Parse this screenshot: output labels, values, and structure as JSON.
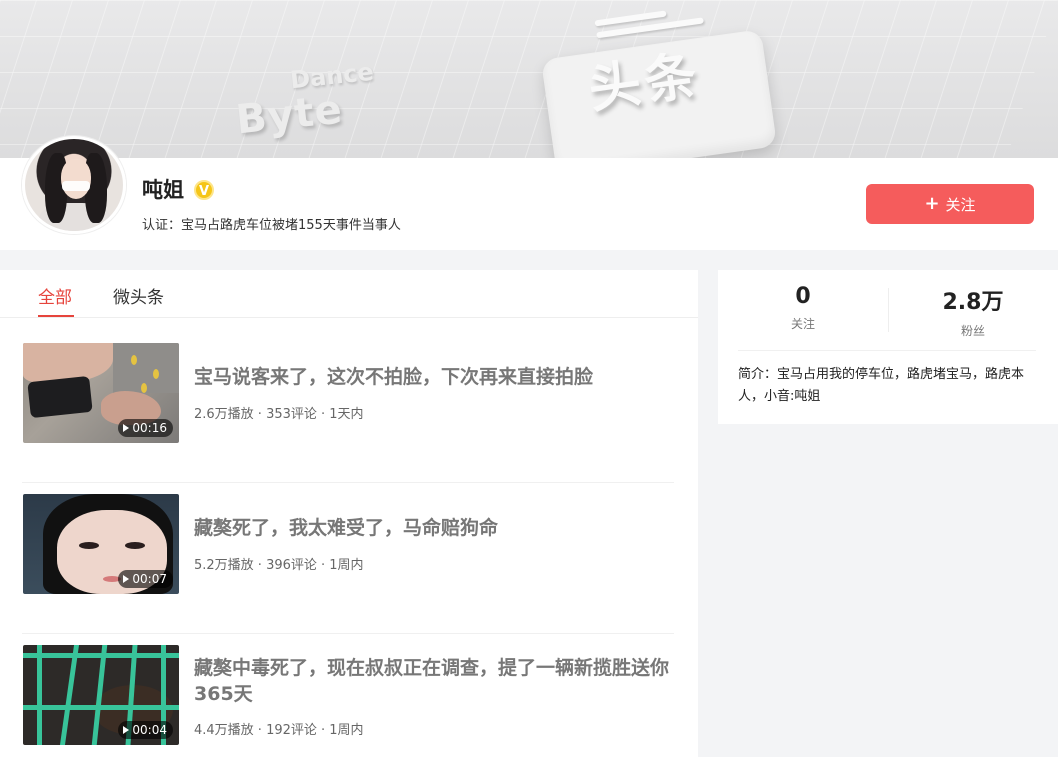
{
  "banner": {
    "text_byte": "Byte",
    "text_dance": "Dance",
    "text_logo": "头条"
  },
  "profile": {
    "name": "吨姐",
    "verified_badge": "V",
    "certification": "认证：宝马占路虎车位被堵155天事件当事人",
    "follow_button": "关注",
    "follow_plus": "+"
  },
  "tabs": [
    {
      "label": "全部",
      "active": true
    },
    {
      "label": "微头条",
      "active": false
    }
  ],
  "feed": [
    {
      "title": "宝马说客来了，这次不拍脸，下次再来直接拍脸",
      "meta": "2.6万播放 · 353评论 · 1天内",
      "duration": "00:16"
    },
    {
      "title": "藏獒死了，我太难受了，马命赔狗命",
      "meta": "5.2万播放 · 396评论 · 1周内",
      "duration": "00:07"
    },
    {
      "title": "藏獒中毒死了，现在叔叔正在调查，提了一辆新揽胜送你365天",
      "meta": "4.4万播放 · 192评论 · 1周内",
      "duration": "00:04"
    }
  ],
  "sidebar": {
    "following_count": "0",
    "following_label": "关注",
    "followers_count": "2.8万",
    "followers_label": "粉丝",
    "bio": "简介：宝马占用我的停车位，路虎堵宝马，路虎本人，小音:吨姐"
  },
  "colors": {
    "accent_red": "#f55c5c",
    "tab_active": "#e6443c",
    "verified_gold": "#f5c518"
  },
  "icons": [
    "verified-icon",
    "plus-icon",
    "play-icon"
  ]
}
